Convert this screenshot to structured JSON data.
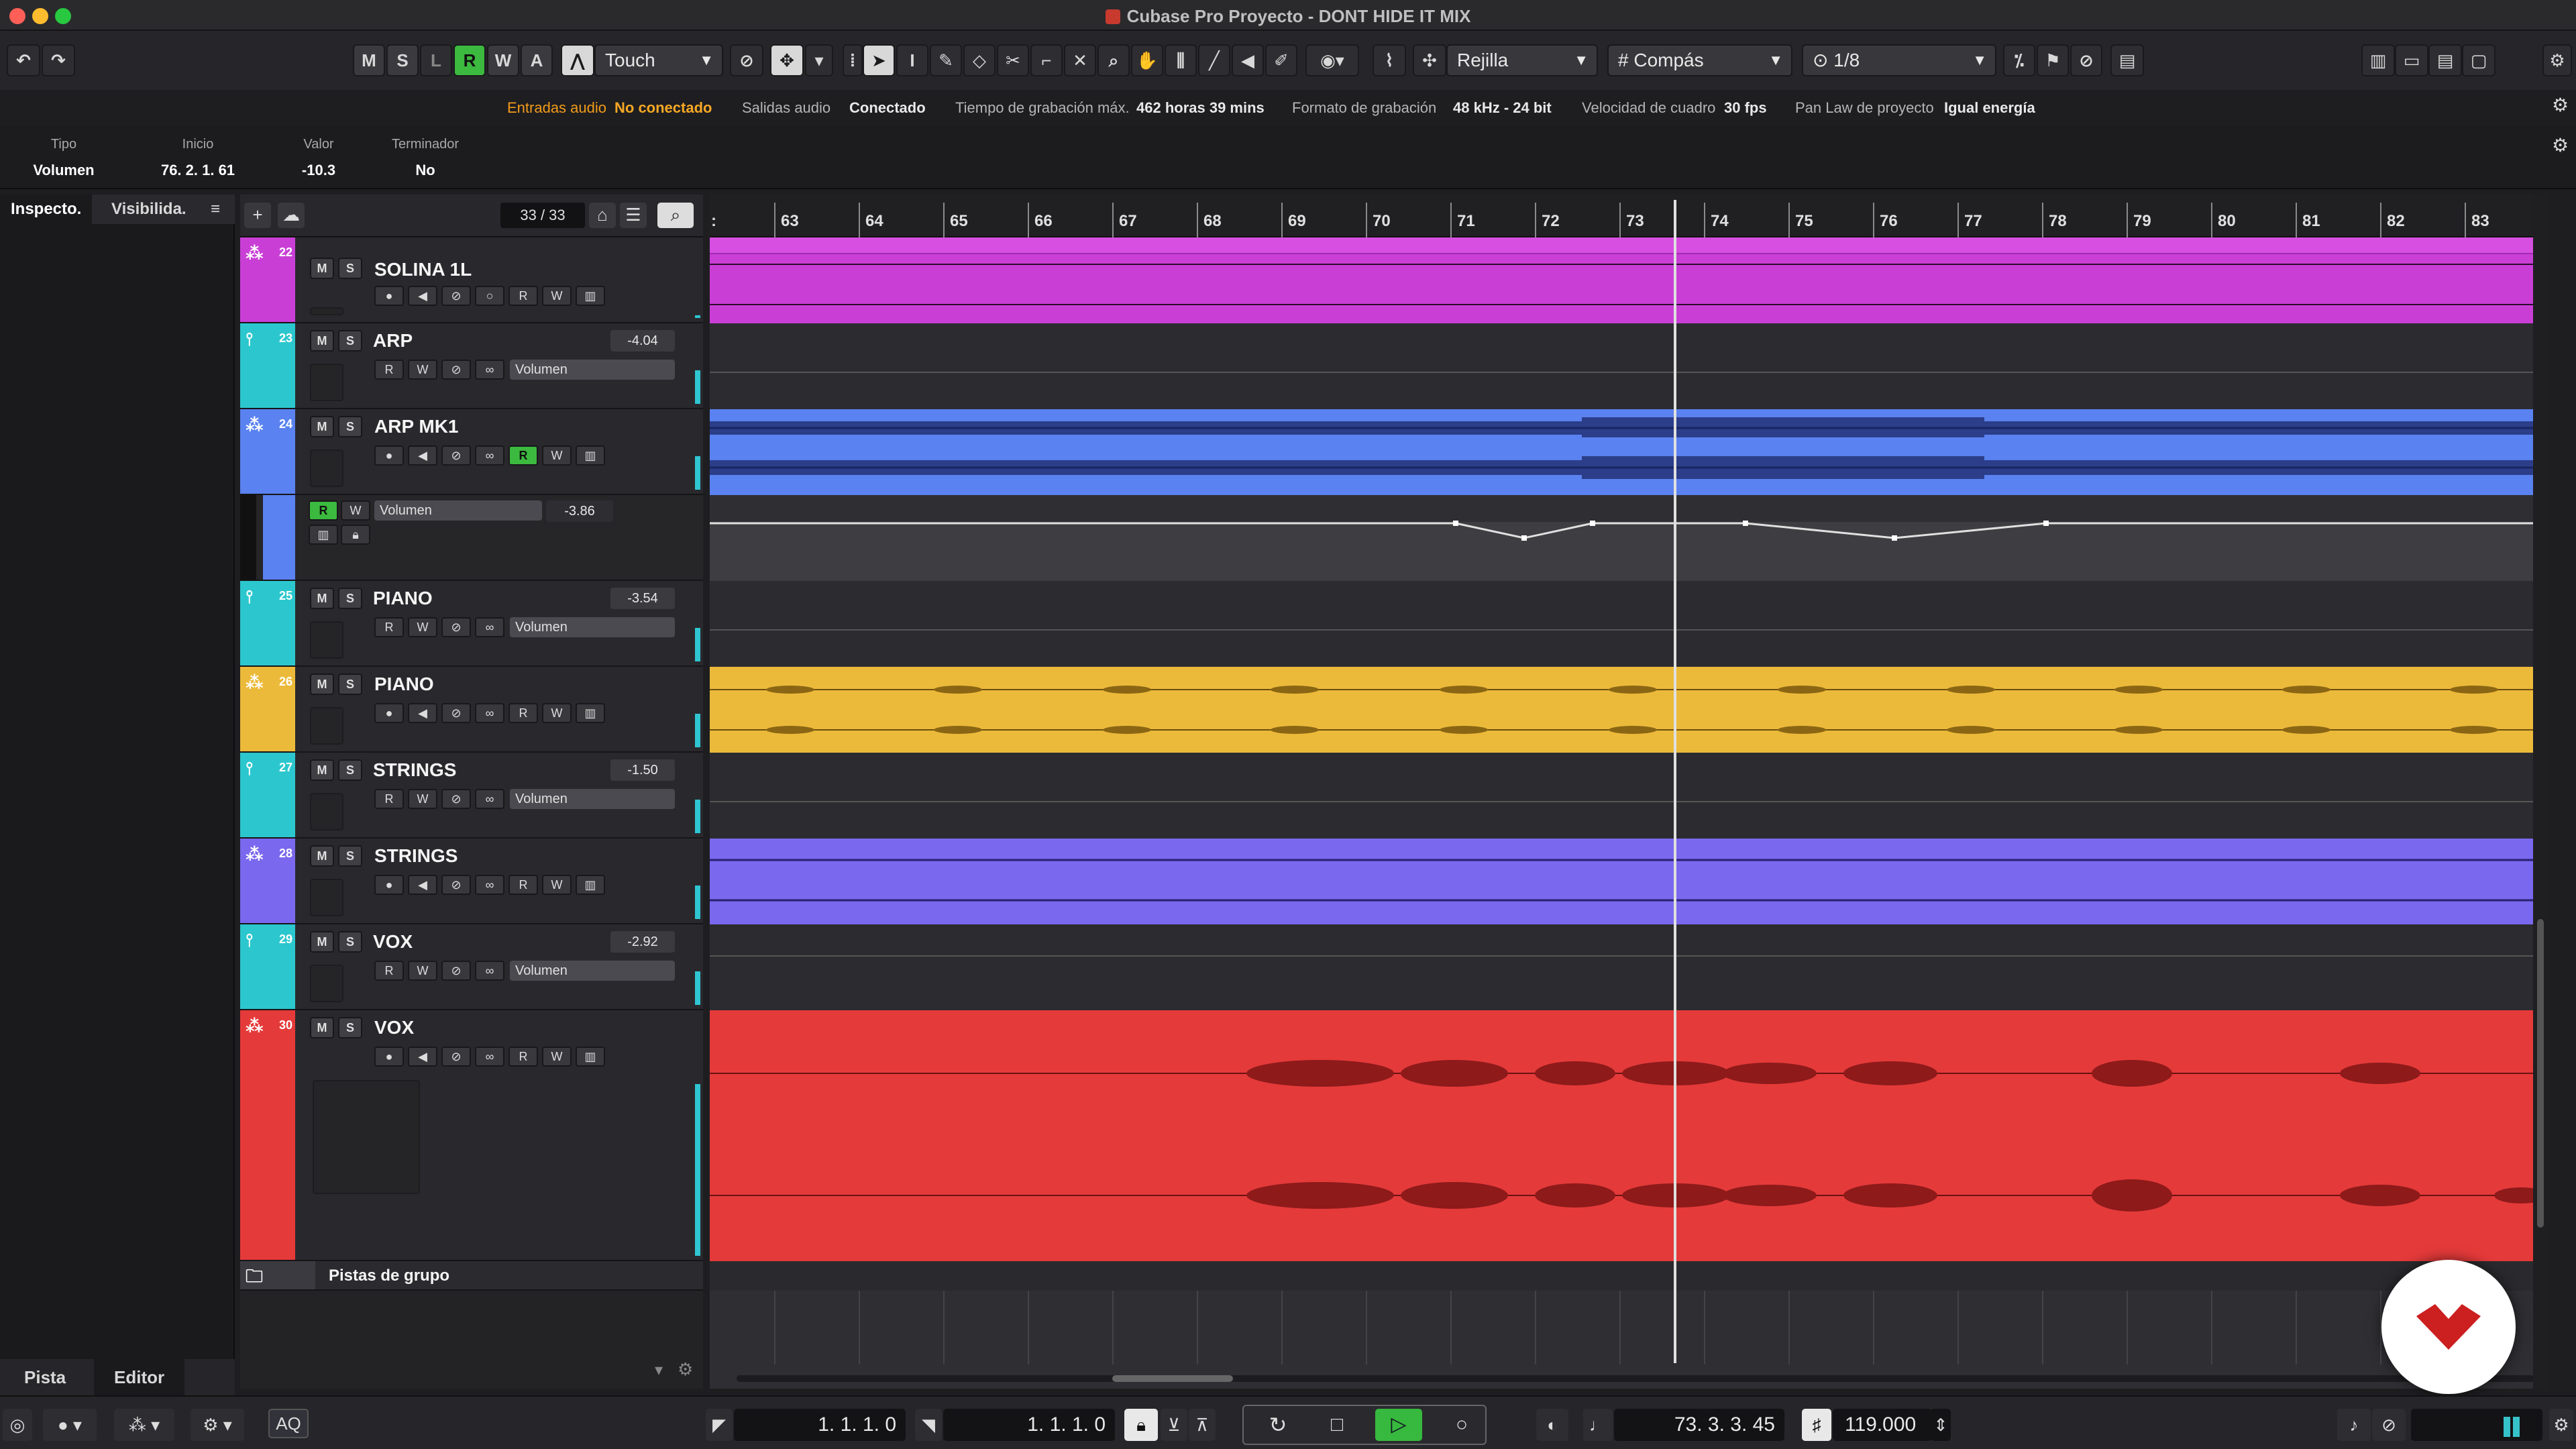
{
  "window": {
    "title": "Cubase Pro Proyecto - DONT HIDE IT MIX"
  },
  "toolbar": {
    "buttons": [
      "M",
      "S",
      "L",
      "R",
      "W",
      "A"
    ],
    "automation_mode": "Touch",
    "snap_type": "Rejilla",
    "grid_type": "Compás",
    "quantize": "1/8"
  },
  "status": {
    "input_label": "Entradas audio",
    "input_value": "No conectado",
    "output_label": "Salidas audio",
    "output_value": "Conectado",
    "rec_time_label": "Tiempo de grabación máx.",
    "rec_time_value": "462 horas 39 mins",
    "format_label": "Formato de grabación",
    "format_value": "48 kHz - 24 bit",
    "frame_label": "Velocidad de cuadro",
    "frame_value": "30 fps",
    "pan_label": "Pan Law de proyecto",
    "pan_value": "Igual energía"
  },
  "infoline": {
    "tipo_label": "Tipo",
    "tipo_value": "Volumen",
    "inicio_label": "Inicio",
    "inicio_value": "76. 2. 1. 61",
    "valor_label": "Valor",
    "valor_value": "-10.3",
    "term_label": "Terminador",
    "term_value": "No"
  },
  "inspector": {
    "tab_inspector": "Inspecto.",
    "tab_visibility": "Visibilida.",
    "tab_menu": "≡",
    "bottom_tab_track": "Pista",
    "bottom_tab_editor": "Editor"
  },
  "track_header": {
    "count": "33 / 33"
  },
  "tracks": [
    {
      "num": "22",
      "name": "SOLINA 1L",
      "type": "audio",
      "color": "#c93fd6"
    },
    {
      "num": "23",
      "name": "ARP",
      "type": "fx",
      "volume": "-4.04",
      "auto": "Volumen",
      "color": "#2cc7ce"
    },
    {
      "num": "24",
      "name": "ARP MK1",
      "type": "audio",
      "color": "#5a82f0"
    },
    {
      "num": "",
      "name": "",
      "type": "automation",
      "auto": "Volumen",
      "volume": "-3.86",
      "color": "#5a82f0"
    },
    {
      "num": "25",
      "name": "PIANO",
      "type": "fx",
      "volume": "-3.54",
      "auto": "Volumen",
      "color": "#2cc7ce"
    },
    {
      "num": "26",
      "name": "PIANO",
      "type": "audio",
      "color": "#ecba3a"
    },
    {
      "num": "27",
      "name": "STRINGS",
      "type": "fx",
      "volume": "-1.50",
      "auto": "Volumen",
      "color": "#2cc7ce"
    },
    {
      "num": "28",
      "name": "STRINGS",
      "type": "audio",
      "color": "#7a68ee"
    },
    {
      "num": "29",
      "name": "VOX",
      "type": "fx",
      "volume": "-2.92",
      "auto": "Volumen",
      "color": "#2cc7ce"
    },
    {
      "num": "30",
      "name": "VOX",
      "type": "audio",
      "color": "#e53a3a"
    }
  ],
  "group_folder": {
    "label": "Pistas de grupo"
  },
  "ruler": {
    "bars": [
      "63",
      "64",
      "65",
      "66",
      "67",
      "68",
      "69",
      "70",
      "71",
      "72",
      "73",
      "74",
      "75",
      "76",
      "77",
      "78",
      "79",
      "80",
      "81",
      "82",
      "83"
    ]
  },
  "transport": {
    "left_locator": "1. 1. 1.   0",
    "right_locator": "1. 1. 1.   0",
    "position": "73.  3.  3.  45",
    "tempo": "119.000",
    "aq": "AQ"
  },
  "colors": {
    "solina": "#c93fd6",
    "arp": "#5a82f0",
    "piano": "#ecba3a",
    "strings": "#7a68ee",
    "vox": "#e53a3a",
    "fx": "#2cc7ce",
    "green": "#3cb93f"
  }
}
